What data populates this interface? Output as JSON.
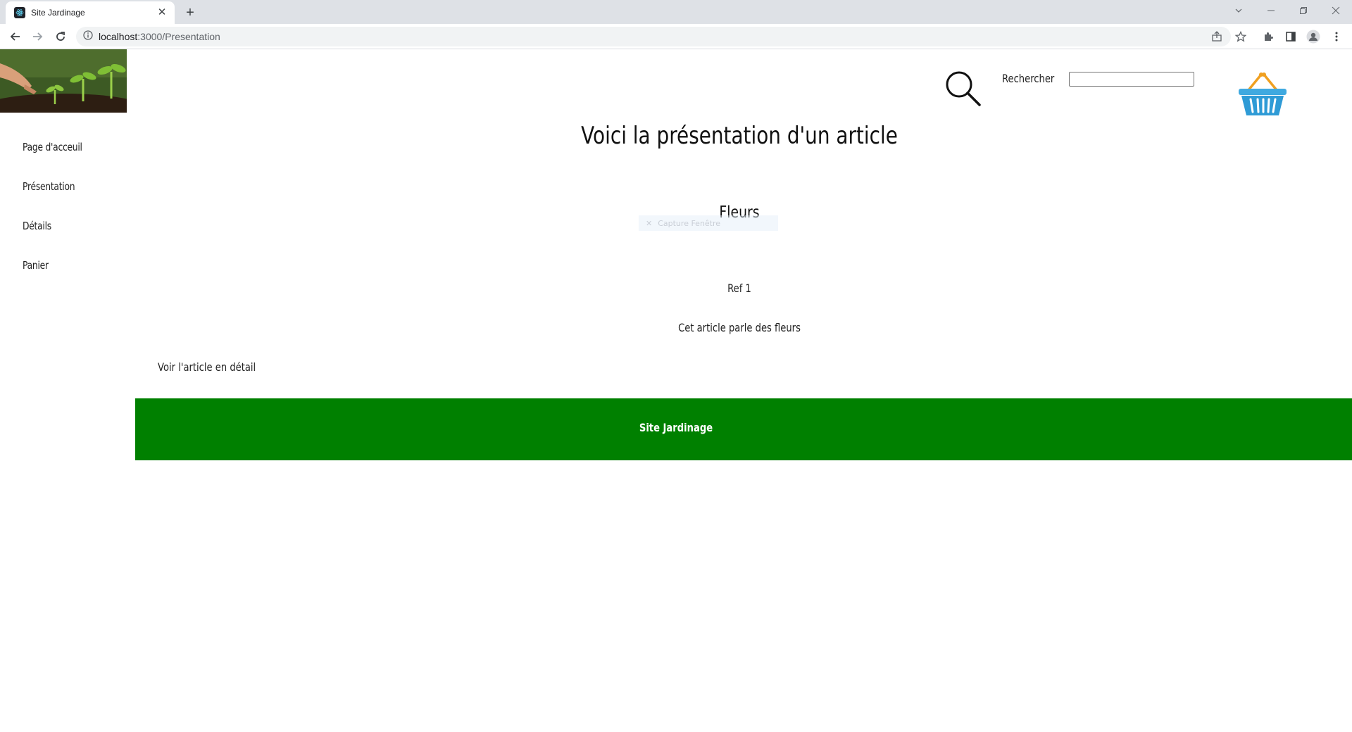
{
  "browser": {
    "tab_title": "Site Jardinage",
    "url_host": "localhost",
    "url_path": ":3000/Presentation"
  },
  "sidebar": {
    "items": [
      {
        "label": "Page d'acceuil"
      },
      {
        "label": "Présentation"
      },
      {
        "label": "Détails"
      },
      {
        "label": "Panier"
      }
    ]
  },
  "header": {
    "search_label": "Rechercher",
    "search_value": ""
  },
  "main": {
    "title": "Voici la présentation d'un article",
    "article_name": "Fleurs",
    "ref": "Ref 1",
    "description": "Cet article parle des fleurs",
    "detail_link": "Voir l'article en détail"
  },
  "overlay": {
    "capture_label": "Capture Fenêtre"
  },
  "footer": {
    "text": "Site Jardinage",
    "color": "#008000"
  },
  "icons": {
    "search": "search-icon",
    "basket": "basket-icon"
  }
}
